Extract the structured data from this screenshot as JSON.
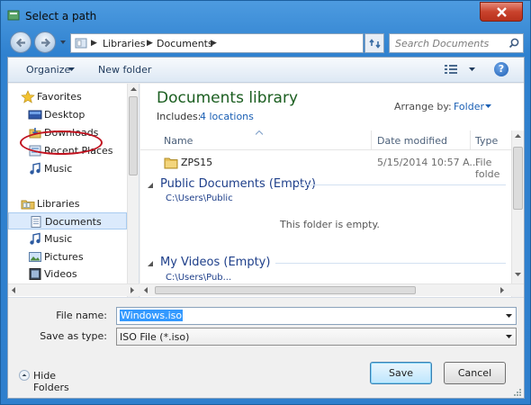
{
  "window": {
    "title": "Select a path"
  },
  "address": {
    "crumbs": [
      "Libraries",
      "Documents"
    ]
  },
  "search": {
    "placeholder": "Search Documents"
  },
  "toolbar": {
    "organize": "Organize",
    "new_folder": "New folder"
  },
  "nav": {
    "favorites": "Favorites",
    "desktop": "Desktop",
    "downloads": "Downloads",
    "recent_places": "Recent Places",
    "music_fav": "Music",
    "libraries": "Libraries",
    "documents": "Documents",
    "music": "Music",
    "pictures": "Pictures",
    "videos": "Videos"
  },
  "library": {
    "title": "Documents library",
    "includes_label": "Includes:",
    "locations": "4 locations",
    "arrange_by_label": "Arrange by:",
    "arrange_by_value": "Folder"
  },
  "columns": {
    "name": "Name",
    "date_modified": "Date modified",
    "type": "Type"
  },
  "files": [
    {
      "name": "ZPS15",
      "date_modified": "5/15/2014 10:57 A...",
      "type": "File folde"
    }
  ],
  "groups": [
    {
      "header": "Public Documents (Empty)",
      "path": "C:\\Users\\Public",
      "empty_msg": "This folder is empty."
    },
    {
      "header": "My Videos (Empty)",
      "path": "C:\\Users\\Pub..."
    }
  ],
  "form": {
    "file_name_label": "File name:",
    "file_name_value": "Windows.iso",
    "save_as_type_label": "Save as type:",
    "save_as_type_value": "ISO File (*.iso)"
  },
  "buttons": {
    "hide_folders": "Hide Folders",
    "save": "Save",
    "cancel": "Cancel"
  },
  "colors": {
    "title_green": "#1b5e20",
    "link_blue": "#1a5fb4",
    "selection": "#3399ff",
    "highlight_circle": "#c1121f"
  }
}
